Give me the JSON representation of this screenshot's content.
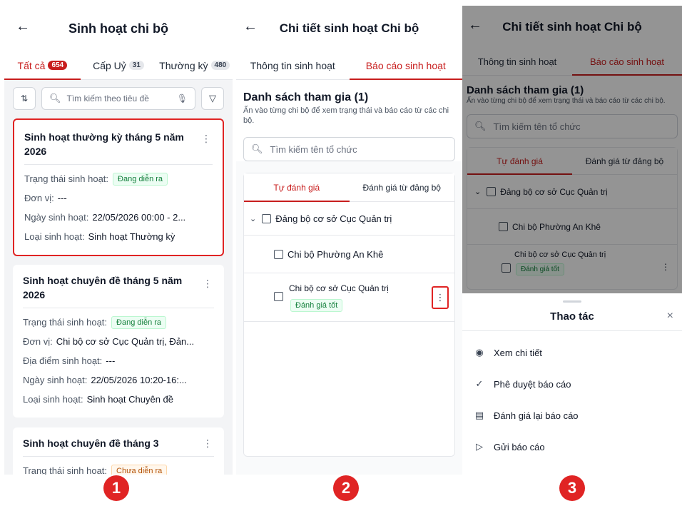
{
  "screen1": {
    "title": "Sinh hoạt chi bộ",
    "tabs": [
      {
        "label": "Tất cả",
        "count": "654"
      },
      {
        "label": "Cấp Uỷ",
        "count": "31"
      },
      {
        "label": "Thường kỳ",
        "count": "480"
      }
    ],
    "search_placeholder": "Tìm kiếm theo tiêu đề",
    "cards": [
      {
        "title": "Sinh hoạt thường kỳ tháng 5 năm 2026",
        "status_label": "Trạng thái sinh hoạt:",
        "status": "Đang diễn ra",
        "unit_label": "Đơn vị:",
        "unit": "---",
        "date_label": "Ngày sinh hoạt:",
        "date": "22/05/2026 00:00 - 2...",
        "type_label": "Loại sinh hoạt:",
        "type": "Sinh hoạt Thường kỳ"
      },
      {
        "title": "Sinh hoạt chuyên đề tháng 5 năm 2026",
        "status_label": "Trạng thái sinh hoạt:",
        "status": "Đang diễn ra",
        "unit_label": "Đơn vị:",
        "unit": "Chi bộ cơ sở Cục Quản trị, Đản...",
        "place_label": "Địa điểm sinh hoạt:",
        "place": "---",
        "date_label": "Ngày sinh hoạt:",
        "date": "22/05/2026 10:20-16:...",
        "type_label": "Loại sinh hoạt:",
        "type": "Sinh hoạt Chuyên đề"
      },
      {
        "title": "Sinh hoạt chuyên đề tháng 3",
        "status_label": "Trạng thái sinh hoạt:",
        "status": "Chưa diễn ra"
      }
    ]
  },
  "screen2": {
    "title": "Chi tiết sinh hoạt Chi bộ",
    "tabs": [
      "Thông tin sinh hoạt",
      "Báo cáo sinh hoạt"
    ],
    "list_title": "Danh sách tham gia (1)",
    "list_desc": "Ấn vào từng chi bộ để xem trạng thái và báo cáo từ các chi bộ.",
    "search_placeholder": "Tìm kiếm tên tổ chức",
    "subtabs": [
      "Tự đánh giá",
      "Đánh giá từ đảng bộ"
    ],
    "tree": {
      "root": "Đảng bộ cơ sở Cục Quản trị",
      "children": [
        {
          "name": "Chi bộ Phường An Khê"
        },
        {
          "name": "Chi bộ cơ sở Cục Quản trị",
          "badge": "Đánh giá tốt"
        }
      ]
    }
  },
  "screen3": {
    "title": "Chi tiết sinh hoạt Chi bộ",
    "tabs": [
      "Thông tin sinh hoạt",
      "Báo cáo sinh hoạt"
    ],
    "list_title": "Danh sách tham gia (1)",
    "list_desc": "Ấn vào từng chi bộ để xem trạng thái và báo cáo từ các chi bộ.",
    "search_placeholder": "Tìm kiếm tên tổ chức",
    "subtabs": [
      "Tự đánh giá",
      "Đánh giá từ đảng bộ"
    ],
    "tree_root": "Đảng bộ cơ sở Cục Quản trị",
    "tree_child1": "Chi bộ Phường An Khê",
    "tree_child2": "Chi bộ cơ sở Cục Quản trị",
    "tree_child2_badge": "Đánh giá tốt",
    "sheet": {
      "title": "Thao tác",
      "actions": [
        {
          "label": "Xem chi tiết",
          "icon": "eye-icon"
        },
        {
          "label": "Phê duyệt báo cáo",
          "icon": "check-circle-icon"
        },
        {
          "label": "Đánh giá lại báo cáo",
          "icon": "document-review-icon"
        },
        {
          "label": "Gửi báo cáo",
          "icon": "send-icon"
        }
      ]
    }
  },
  "markers": [
    "1",
    "2",
    "3"
  ],
  "colors": {
    "accent": "#c81e1e",
    "marker": "#e02424",
    "success": "#15803d"
  }
}
